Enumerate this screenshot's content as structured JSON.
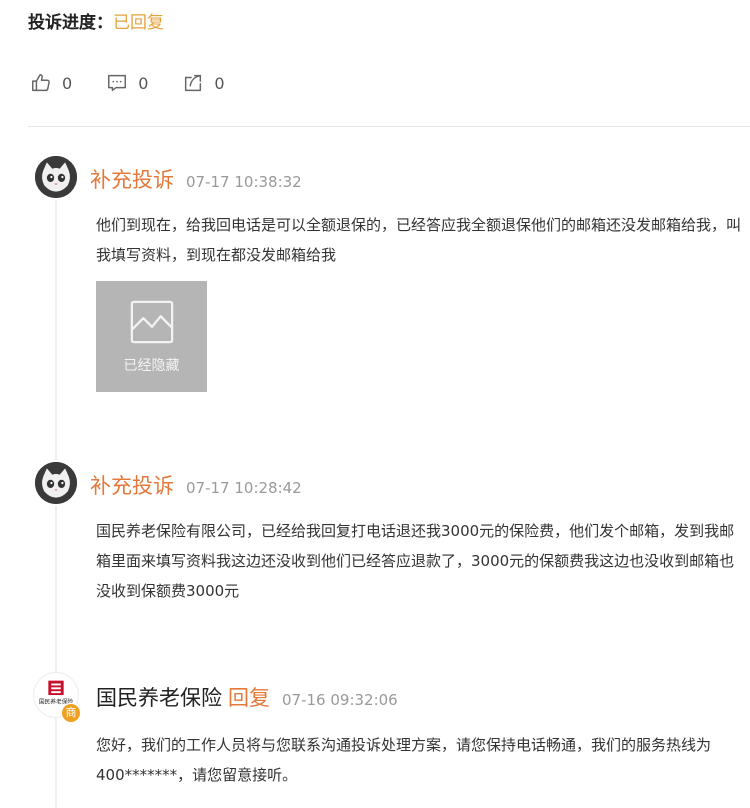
{
  "status": {
    "label": "投诉进度：",
    "value": "已回复"
  },
  "actions": {
    "like_count": "0",
    "comment_count": "0",
    "share_count": "0"
  },
  "entries": [
    {
      "author": "补充投诉",
      "time": "07-17 10:38:32",
      "text": "他们到现在，给我回电话是可以全额退保的，已经答应我全额退保他们的邮箱还没发邮箱给我，叫我填写资料，到现在都没发邮箱给我",
      "image_label": "已经隐藏"
    },
    {
      "author": "补充投诉",
      "time": "07-17 10:28:42",
      "text": "国民养老保险有限公司，已经给我回复打电话退还我3000元的保险费，他们发个邮箱，发到我邮箱里面来填写资料我这边还没收到他们已经答应退款了，3000元的保额费我这边也没收到邮箱也没收到保额费3000元"
    },
    {
      "author": "国民养老保险",
      "reply_tag": "回复",
      "time": "07-16 09:32:06",
      "badge": "商",
      "logo_text": "国民养老保险",
      "text": "您好，我们的工作人员将与您联系沟通投诉处理方案，请您保持电话畅通，我们的服务热线为400*******，请您留意接听。"
    }
  ],
  "colors": {
    "accent": "#e4793c",
    "status": "#e6a23c",
    "muted": "#999999"
  }
}
